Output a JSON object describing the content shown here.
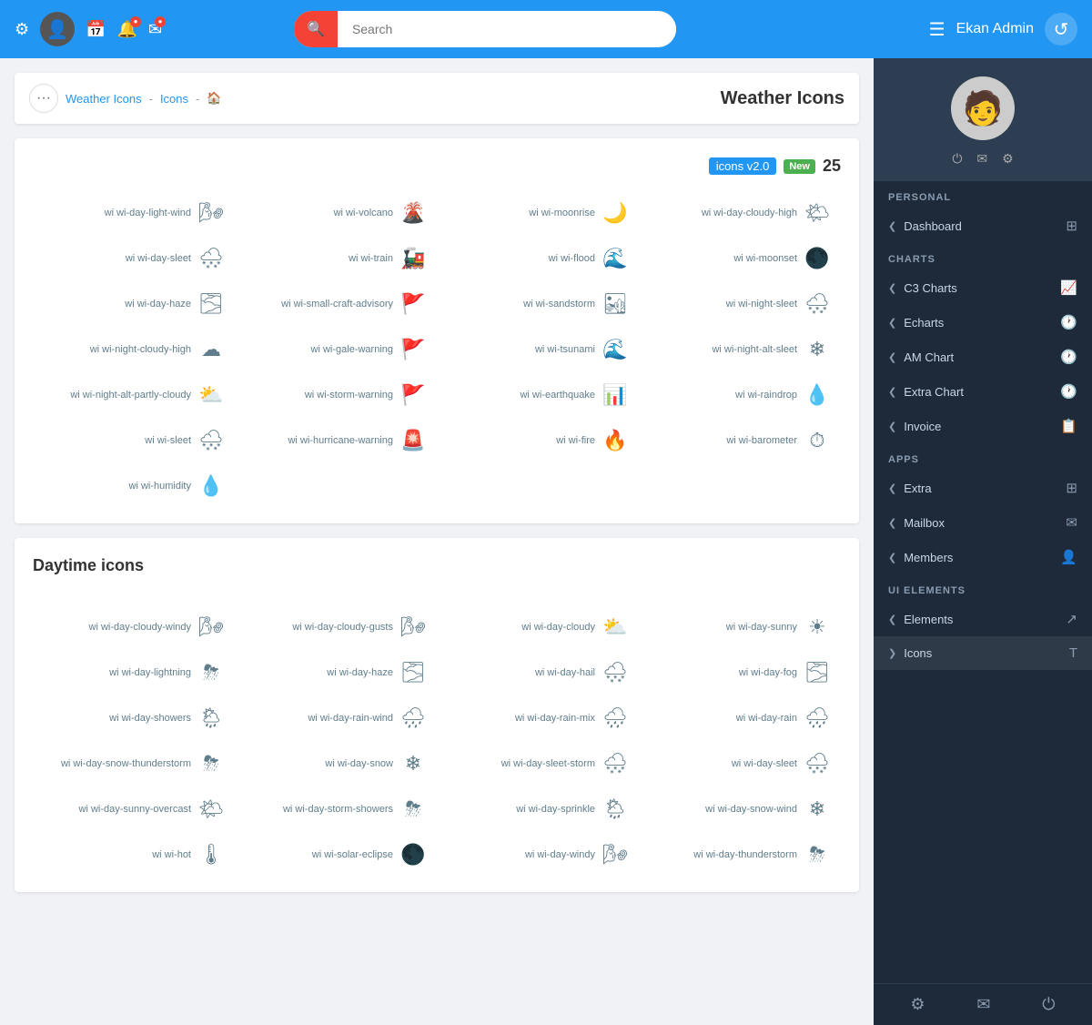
{
  "topnav": {
    "search_placeholder": "Search",
    "brand_name": "Ekan Admin"
  },
  "breadcrumb": {
    "item1": "Weather Icons",
    "sep1": "-",
    "item2": "Icons",
    "sep2": "-",
    "current": "🏠"
  },
  "page_title": "Weather Icons",
  "card1": {
    "version": "icons v2.0",
    "badge": "New",
    "count": "25",
    "icons": [
      {
        "name": "wi wi-day-light-wind",
        "symbol": "🌬"
      },
      {
        "name": "wi wi-volcano",
        "symbol": "🌋"
      },
      {
        "name": "wi wi-moonrise",
        "symbol": "🌙"
      },
      {
        "name": "wi wi-day-cloudy-high",
        "symbol": "🌤"
      },
      {
        "name": "wi wi-day-sleet",
        "symbol": "🌨"
      },
      {
        "name": "wi wi-train",
        "symbol": "🚂"
      },
      {
        "name": "wi wi-flood",
        "symbol": "🌊"
      },
      {
        "name": "wi wi-moonset",
        "symbol": "🌑"
      },
      {
        "name": "wi wi-day-haze",
        "symbol": "🌫"
      },
      {
        "name": "wi wi-small-craft-advisory",
        "symbol": "🚩"
      },
      {
        "name": "wi wi-sandstorm",
        "symbol": "🏜"
      },
      {
        "name": "wi wi-night-sleet",
        "symbol": "🌨"
      },
      {
        "name": "wi wi-night-cloudy-high",
        "symbol": "☁"
      },
      {
        "name": "wi wi-gale-warning",
        "symbol": "🚩"
      },
      {
        "name": "wi wi-tsunami",
        "symbol": "🌊"
      },
      {
        "name": "wi wi-night-alt-sleet",
        "symbol": "❄"
      },
      {
        "name": "wi wi-night-alt-partly-cloudy",
        "symbol": "⛅"
      },
      {
        "name": "wi wi-storm-warning",
        "symbol": "🚩"
      },
      {
        "name": "wi wi-earthquake",
        "symbol": "📊"
      },
      {
        "name": "wi wi-raindrop",
        "symbol": "💧"
      },
      {
        "name": "wi wi-sleet",
        "symbol": "🌨"
      },
      {
        "name": "wi wi-hurricane-warning",
        "symbol": "🚨"
      },
      {
        "name": "wi wi-fire",
        "symbol": "🔥"
      },
      {
        "name": "wi wi-barometer",
        "symbol": "⏱"
      },
      {
        "name": "",
        "symbol": ""
      },
      {
        "name": "",
        "symbol": ""
      },
      {
        "name": "",
        "symbol": ""
      },
      {
        "name": "wi wi-humidity",
        "symbol": "💧"
      }
    ]
  },
  "card2": {
    "title": "Daytime icons",
    "icons": [
      {
        "name": "wi wi-day-cloudy-windy",
        "symbol": "🌬"
      },
      {
        "name": "wi wi-day-cloudy-gusts",
        "symbol": "🌬"
      },
      {
        "name": "wi wi-day-cloudy",
        "symbol": "⛅"
      },
      {
        "name": "wi wi-day-sunny",
        "symbol": "☀"
      },
      {
        "name": "wi wi-day-lightning",
        "symbol": "⛈"
      },
      {
        "name": "wi wi-day-haze",
        "symbol": "🌫"
      },
      {
        "name": "wi wi-day-hail",
        "symbol": "🌨"
      },
      {
        "name": "wi wi-day-fog",
        "symbol": "🌫"
      },
      {
        "name": "wi wi-day-showers",
        "symbol": "🌦"
      },
      {
        "name": "wi wi-day-rain-wind",
        "symbol": "🌧"
      },
      {
        "name": "wi wi-day-rain-mix",
        "symbol": "🌧"
      },
      {
        "name": "wi wi-day-rain",
        "symbol": "🌧"
      },
      {
        "name": "wi wi-day-snow-thunderstorm",
        "symbol": "⛈"
      },
      {
        "name": "wi wi-day-snow",
        "symbol": "❄"
      },
      {
        "name": "wi wi-day-sleet-storm",
        "symbol": "🌨"
      },
      {
        "name": "wi wi-day-sleet",
        "symbol": "🌨"
      },
      {
        "name": "wi wi-day-sunny-overcast",
        "symbol": "🌤"
      },
      {
        "name": "wi wi-day-storm-showers",
        "symbol": "⛈"
      },
      {
        "name": "wi wi-day-sprinkle",
        "symbol": "🌦"
      },
      {
        "name": "wi wi-day-snow-wind",
        "symbol": "❄"
      },
      {
        "name": "wi wi-hot",
        "symbol": "🌡"
      },
      {
        "name": "wi wi-solar-eclipse",
        "symbol": "🌑"
      },
      {
        "name": "wi wi-day-windy",
        "symbol": "🌬"
      },
      {
        "name": "wi wi-day-thunderstorm",
        "symbol": "⛈"
      }
    ]
  },
  "sidebar": {
    "personal_label": "PERSONAL",
    "charts_label": "CHARTS",
    "apps_label": "APPS",
    "ui_label": "UI ELEMENTS",
    "dashboard": "Dashboard",
    "c3charts": "C3 Charts",
    "echarts": "Echarts",
    "am_chart": "AM Chart",
    "extra_chart": "Extra Chart",
    "invoice": "Invoice",
    "extra": "Extra",
    "mailbox": "Mailbox",
    "members": "Members",
    "elements": "Elements",
    "icons": "Icons"
  }
}
